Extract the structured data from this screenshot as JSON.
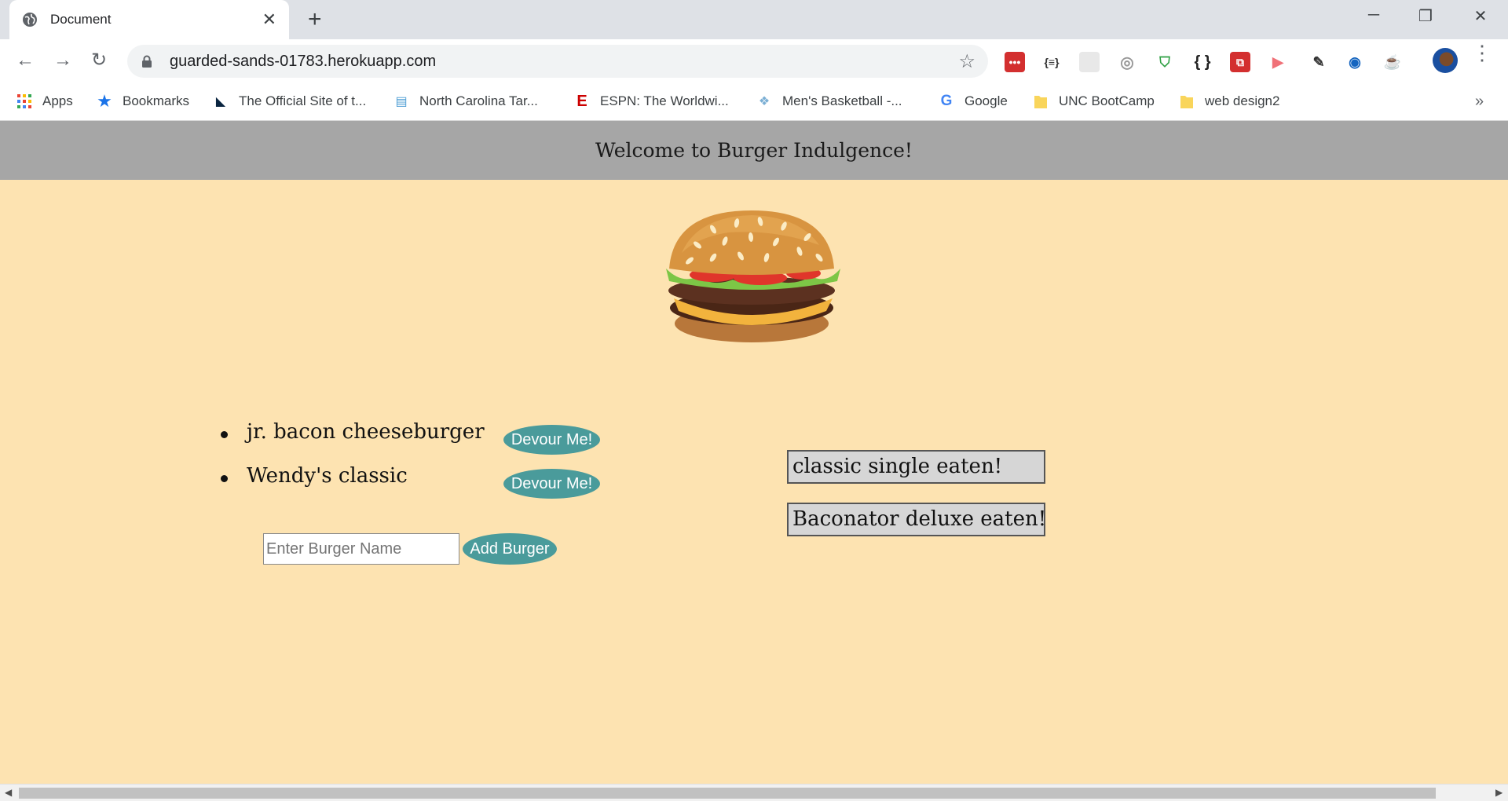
{
  "browser": {
    "tab_title": "Document",
    "url": "guarded-sands-01783.herokuapp.com",
    "bookmarks": [
      {
        "label": "Apps",
        "icon": "apps-grid-icon"
      },
      {
        "label": "Bookmarks",
        "icon": "star-icon"
      },
      {
        "label": "The Official Site of t...",
        "icon": "panthers-logo-icon"
      },
      {
        "label": "North Carolina Tar...",
        "icon": "unc-flag-icon"
      },
      {
        "label": "ESPN: The Worldwi...",
        "icon": "espn-icon"
      },
      {
        "label": "Men's Basketball -...",
        "icon": "tarheel-icon"
      },
      {
        "label": "Google",
        "icon": "google-icon"
      },
      {
        "label": "UNC BootCamp",
        "icon": "folder-icon"
      },
      {
        "label": "web design2",
        "icon": "folder-icon"
      }
    ],
    "accent_color": "#1a73e8"
  },
  "page": {
    "header_title": "Welcome to Burger Indulgence!",
    "background_color": "#fde3b1",
    "button_color": "#4a9b9b",
    "burgers": [
      {
        "name": "jr. bacon cheeseburger",
        "button": "Devour Me!"
      },
      {
        "name": "Wendy's classic",
        "button": "Devour Me!"
      }
    ],
    "form": {
      "placeholder": "Enter Burger Name",
      "value": "",
      "submit_label": "Add Burger"
    },
    "eaten": [
      "classic single eaten!",
      "Baconator deluxe eaten!"
    ]
  }
}
